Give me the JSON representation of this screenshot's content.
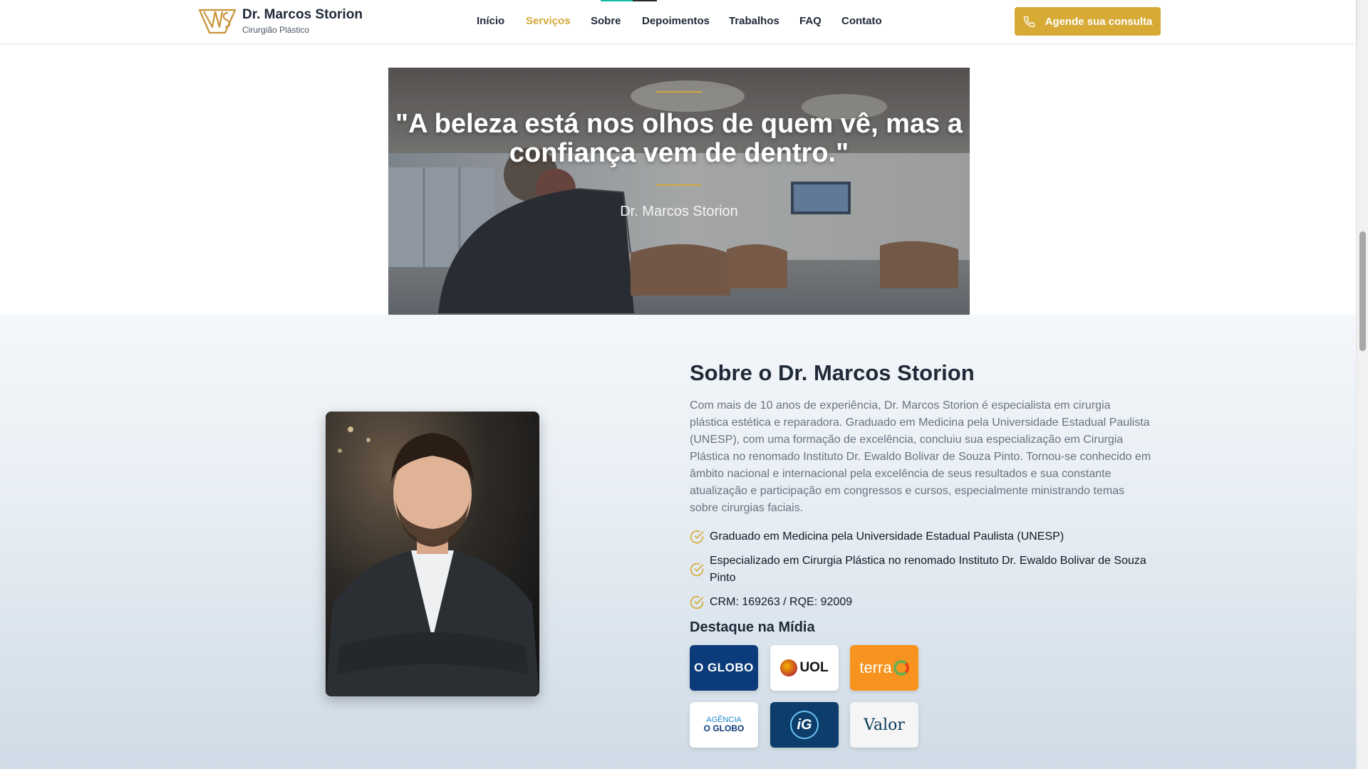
{
  "header": {
    "brand_name": "Dr. Marcos Storion",
    "brand_subtitle": "Cirurgião Plástico",
    "nav": {
      "inicio": "Início",
      "servicos": "Serviços",
      "sobre": "Sobre",
      "depoimentos": "Depoimentos",
      "trabalhos": "Trabalhos",
      "faq": "FAQ",
      "contato": "Contato"
    },
    "active_nav": "Serviços",
    "cta_label": "Agende sua consulta",
    "cta_icon": "phone-icon"
  },
  "quote": {
    "text": "\"A beleza está nos olhos de quem vê, mas a confiança vem de dentro.\"",
    "author": "Dr. Marcos Storion"
  },
  "about": {
    "title": "Sobre o Dr. Marcos Storion",
    "description": "Com mais de 10 anos de experiência, Dr. Marcos Storion é especialista em cirurgia plástica estética e reparadora. Graduado em Medicina pela Universidade Estadual Paulista (UNESP), com uma formação de excelência, concluiu sua especialização em Cirurgia Plástica no renomado Instituto Dr. Ewaldo Bolivar de Souza Pinto. Tornou-se conhecido em âmbito nacional e internacional pela excelência de seus resultados e sua constante atualização e participação em congressos e cursos, especialmente ministrando temas sobre cirurgias faciais.",
    "bullets": [
      "Graduado em Medicina pela Universidade Estadual Paulista (UNESP)",
      "Especializado em Cirurgia Plástica no renomado Instituto Dr. Ewaldo Bolivar de Souza Pinto",
      "CRM: 169263 / RQE: 92009"
    ],
    "bullet_icon": "check-circle-icon",
    "media_title": "Destaque na Mídia",
    "media": {
      "oglobo": "O GLOBO",
      "uol": "UOL",
      "terra": "terra",
      "agencia_line1": "AGÊNCIA",
      "agencia_line2": "O GLOBO",
      "ig": "iG",
      "valor": "Valor"
    }
  },
  "colors": {
    "accent_gold": "#d7aa36",
    "text_dark": "#1f2937",
    "text_muted": "#6b7280",
    "oglobo_blue": "#0b3b7a",
    "terra_orange": "#f7931e",
    "ig_blue": "#0d3d6b"
  }
}
